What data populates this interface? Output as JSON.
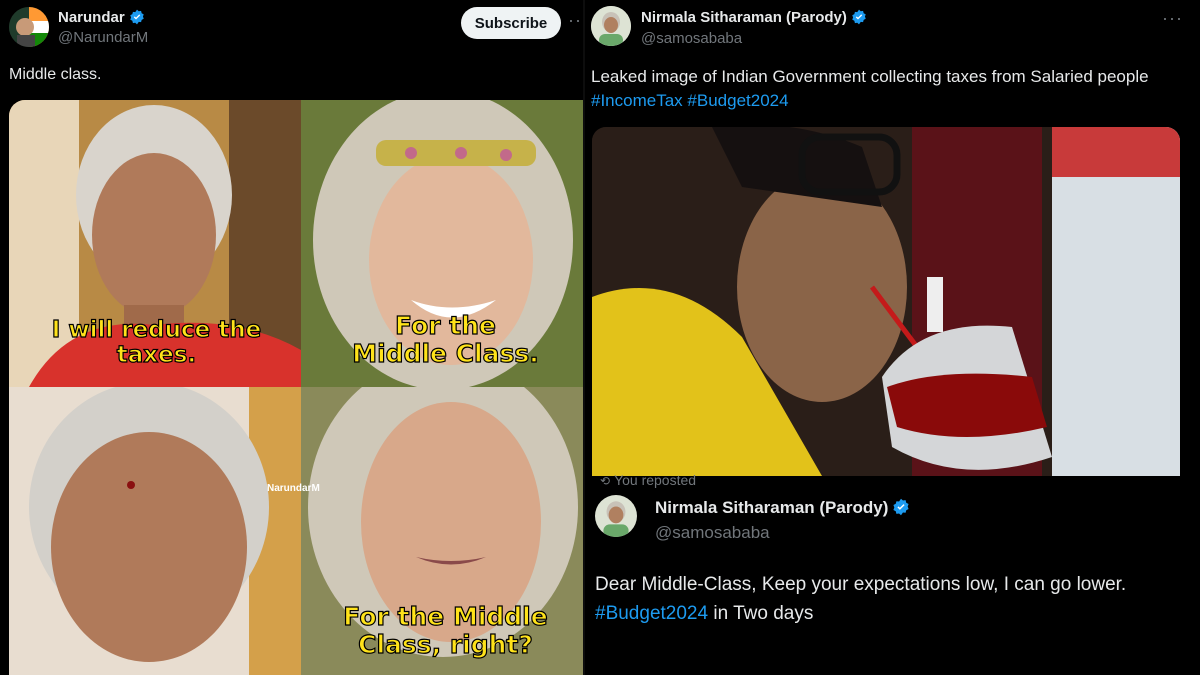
{
  "left_tweet": {
    "author_name": "Narundar",
    "author_handle": "@NarundarM",
    "subscribe_label": "Subscribe",
    "more_label": "···",
    "text": "Middle class.",
    "meme": {
      "caption_1": [
        "I will reduce the",
        "taxes."
      ],
      "caption_2": [
        "For the",
        "Middle Class."
      ],
      "caption_3": [
        "For the Middle",
        "Class, right?"
      ],
      "watermark": "NarundarM"
    }
  },
  "right_tweet": {
    "author_name": "Nirmala Sitharaman (Parody)",
    "author_handle": "@samosababa",
    "more_label": "···",
    "text": "Leaked image of Indian Government collecting taxes from Salaried people",
    "hashtags": [
      "#IncomeTax",
      "#Budget2024"
    ]
  },
  "quoted_tweet": {
    "reposted_label": "You reposted",
    "author_name": "Nirmala Sitharaman (Parody)",
    "author_handle": "@samosababa",
    "text": "Dear Middle-Class, Keep your expectations low, I can go lower.",
    "hashtag": "#Budget2024",
    "text_after": " in Two days"
  },
  "colors": {
    "background": "#000000",
    "link": "#1d9bf0",
    "verified": "#1d9bf0",
    "caption": "#ffe31a"
  }
}
